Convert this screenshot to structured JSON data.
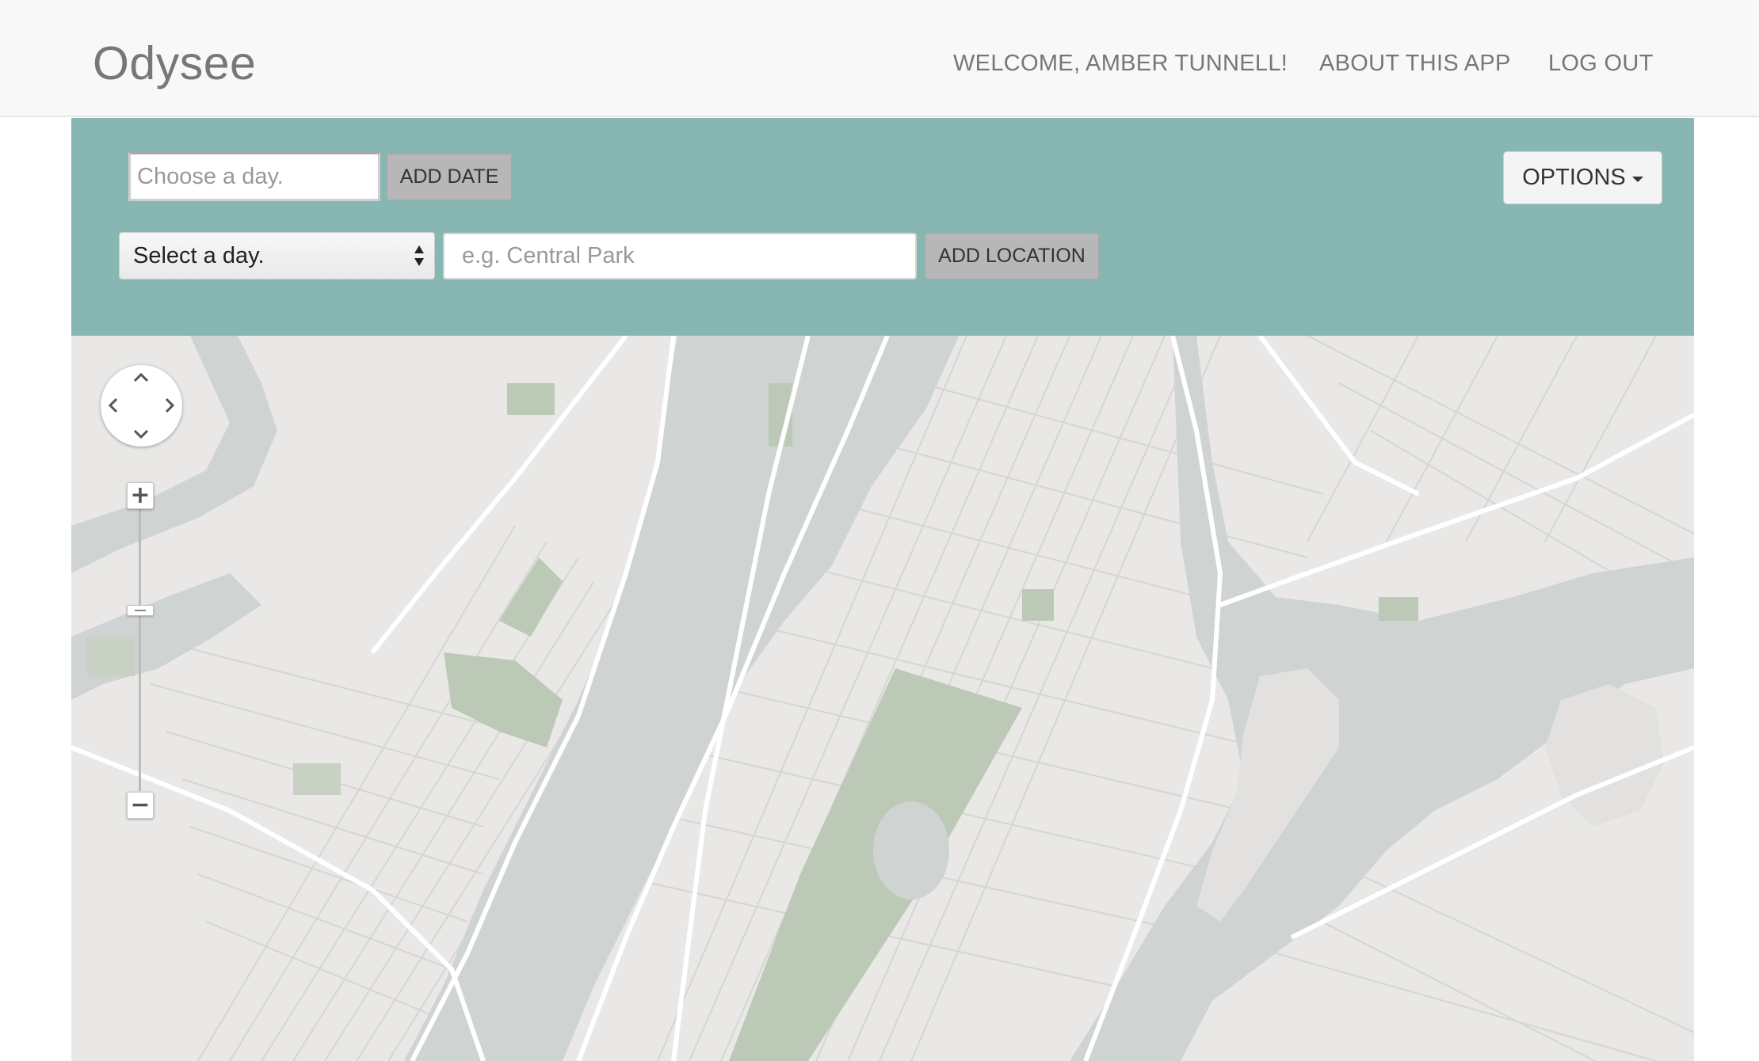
{
  "navbar": {
    "brand": "Odysee",
    "welcome": "WELCOME, AMBER TUNNELL!",
    "about": "ABOUT THIS APP",
    "logout": "LOG OUT"
  },
  "controls": {
    "date_input_placeholder": "Choose a day.",
    "add_date_label": "ADD DATE",
    "day_select_value": "Select a day.",
    "location_placeholder": "e.g. Central Park",
    "add_location_label": "ADD LOCATION",
    "options_label": "OPTIONS"
  },
  "map": {
    "zoom_in_label": "+",
    "zoom_out_label": "−",
    "water_color": "#cfd3d1",
    "park_color": "#bcc9b6",
    "land_color": "#e9e8e6",
    "road_color": "#ffffff"
  },
  "colors": {
    "panel_bg": "#88b6b2",
    "navbar_bg": "#f8f8f8"
  }
}
